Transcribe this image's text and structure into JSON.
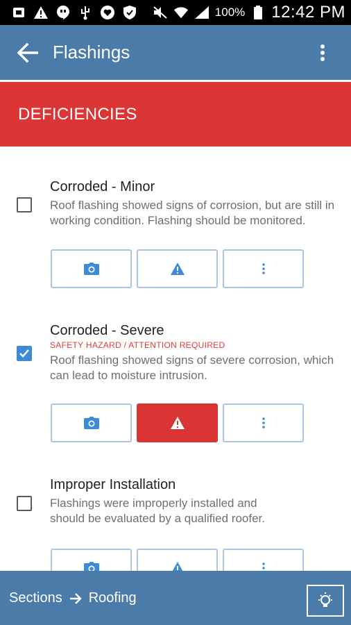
{
  "status_bar": {
    "battery_percent": "100%",
    "time": "12:42 PM",
    "icons": [
      "screenshot-icon",
      "warning-icon",
      "hangouts-icon",
      "usb-icon",
      "heart-icon",
      "shield-icon",
      "mute-icon",
      "wifi-icon",
      "signal-icon",
      "battery-icon"
    ]
  },
  "app_bar": {
    "title": "Flashings",
    "back_icon": "arrow-back-icon",
    "menu_icon": "more-vert-icon"
  },
  "section": {
    "title": "DEFICIENCIES",
    "color": "#dc3535"
  },
  "items": [
    {
      "title": "Corroded - Minor",
      "checked": false,
      "hazard": "",
      "description": "Roof flashing showed signs of corrosion, but are still in working condition. Flashing should be monitored.",
      "hazard_active": false
    },
    {
      "title": "Corroded - Severe",
      "checked": true,
      "hazard": "SAFETY HAZARD / ATTENTION REQUIRED",
      "description": "Roof flashing showed signs of severe corrosion, which can lead to moisture intrusion.",
      "hazard_active": true
    },
    {
      "title": "Improper Installation",
      "checked": false,
      "hazard": "",
      "description_line1": "Flashings were improperly installed and",
      "description_line2": "should be evaluated by a qualified roofer.",
      "hazard_active": false
    }
  ],
  "bottom_bar": {
    "crumb_1": "Sections",
    "crumb_2": "Roofing",
    "tip_icon": "lightbulb-icon"
  },
  "colors": {
    "primary": "#4a7ba9",
    "accent": "#3d8ad6",
    "danger": "#dc3535",
    "button_border": "#a8c5e6"
  }
}
